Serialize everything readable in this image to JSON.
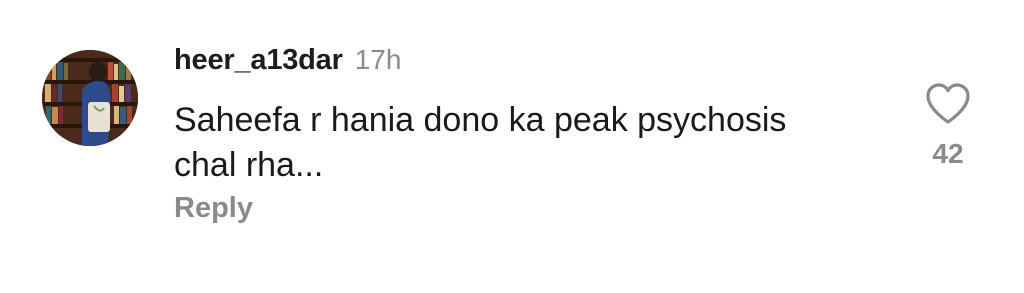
{
  "comment": {
    "username": "heer_a13dar",
    "time": "17h",
    "text": "Saheefa r hania dono ka peak psychosis\nchal rha...",
    "reply_label": "Reply",
    "like_count": "42",
    "icons": {
      "avatar": "avatar-photo",
      "like": "heart-outline-icon"
    }
  },
  "colors": {
    "username": "#1c1c1c",
    "secondary_text": "#8a8a8a",
    "body_text": "#1a1a1a",
    "background": "#ffffff"
  }
}
